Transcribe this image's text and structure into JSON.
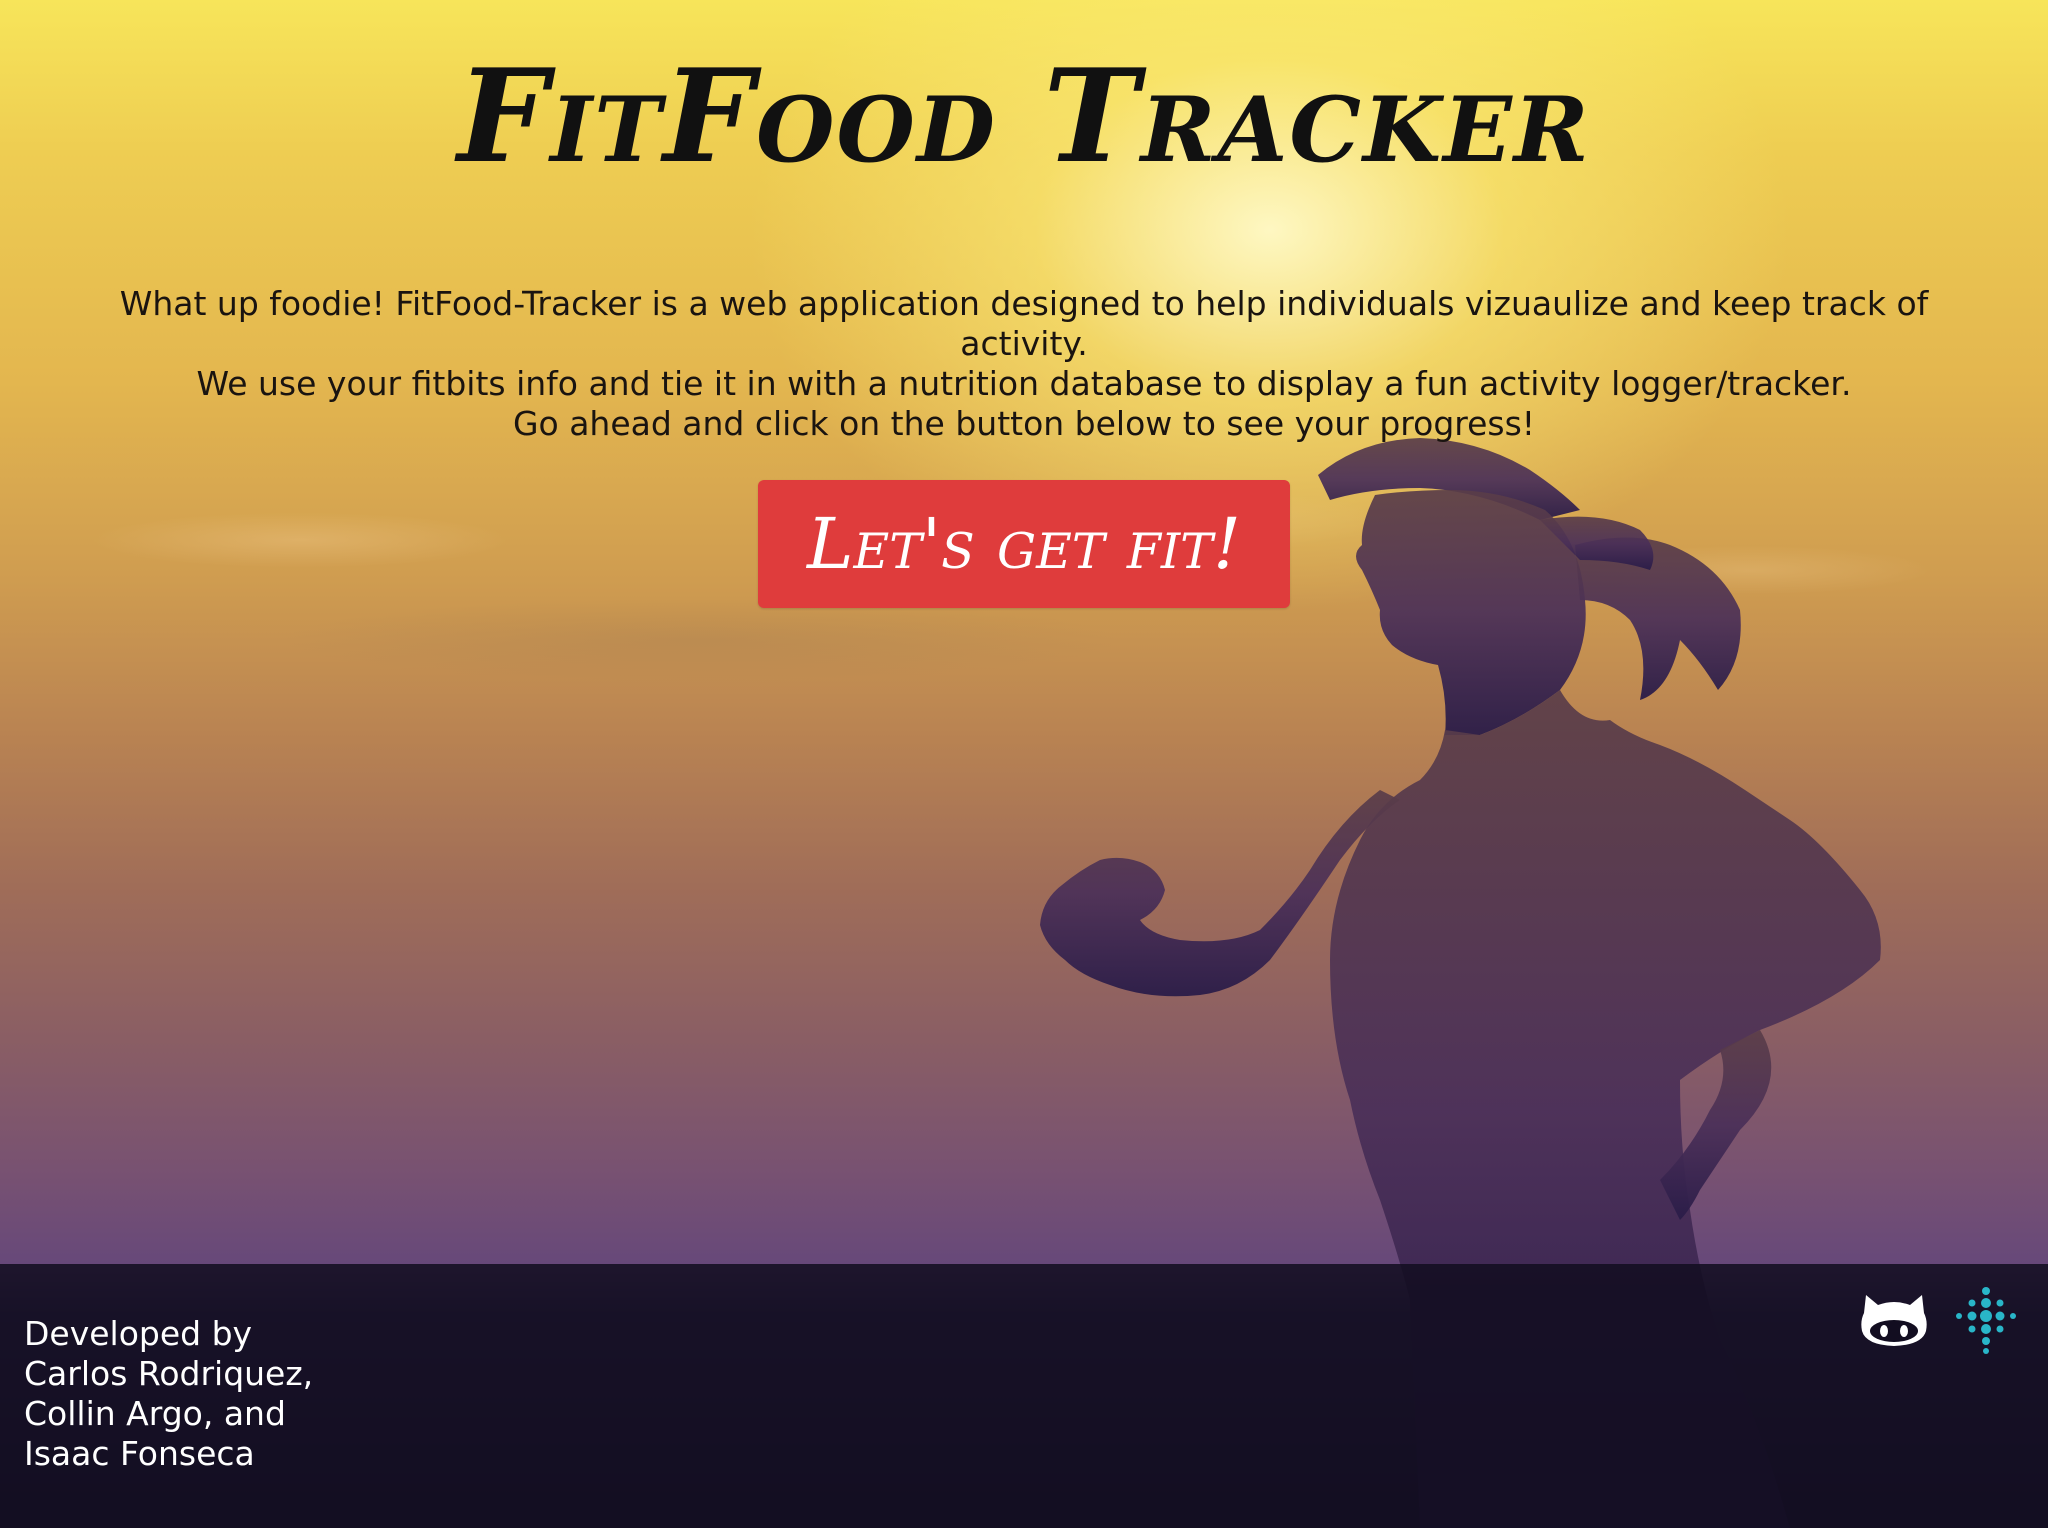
{
  "header": {
    "title": "FitFood Tracker"
  },
  "intro": {
    "line1": "What up foodie! FitFood-Tracker is a web application designed to help individuals vizuaulize and keep track of",
    "line2": "activity.",
    "line3": "We use your fitbits info and tie it in with a nutrition database to display a fun activity logger/tracker.",
    "line4": "Go ahead and click on the button below to see your progress!"
  },
  "cta": {
    "label": "Let's get fit!",
    "color": "#df3c3c"
  },
  "footer": {
    "developed_by": "Developed by",
    "dev1": "Carlos Rodriquez,",
    "dev2": "Collin Argo, and",
    "dev3": "Isaac Fonseca",
    "icons": [
      "github-icon",
      "fitbit-icon"
    ]
  },
  "colors": {
    "fitbit": "#29b6c8",
    "footer_bg": "#120d20",
    "sky_top": "#f7e55a",
    "sky_bottom": "#66487a"
  }
}
